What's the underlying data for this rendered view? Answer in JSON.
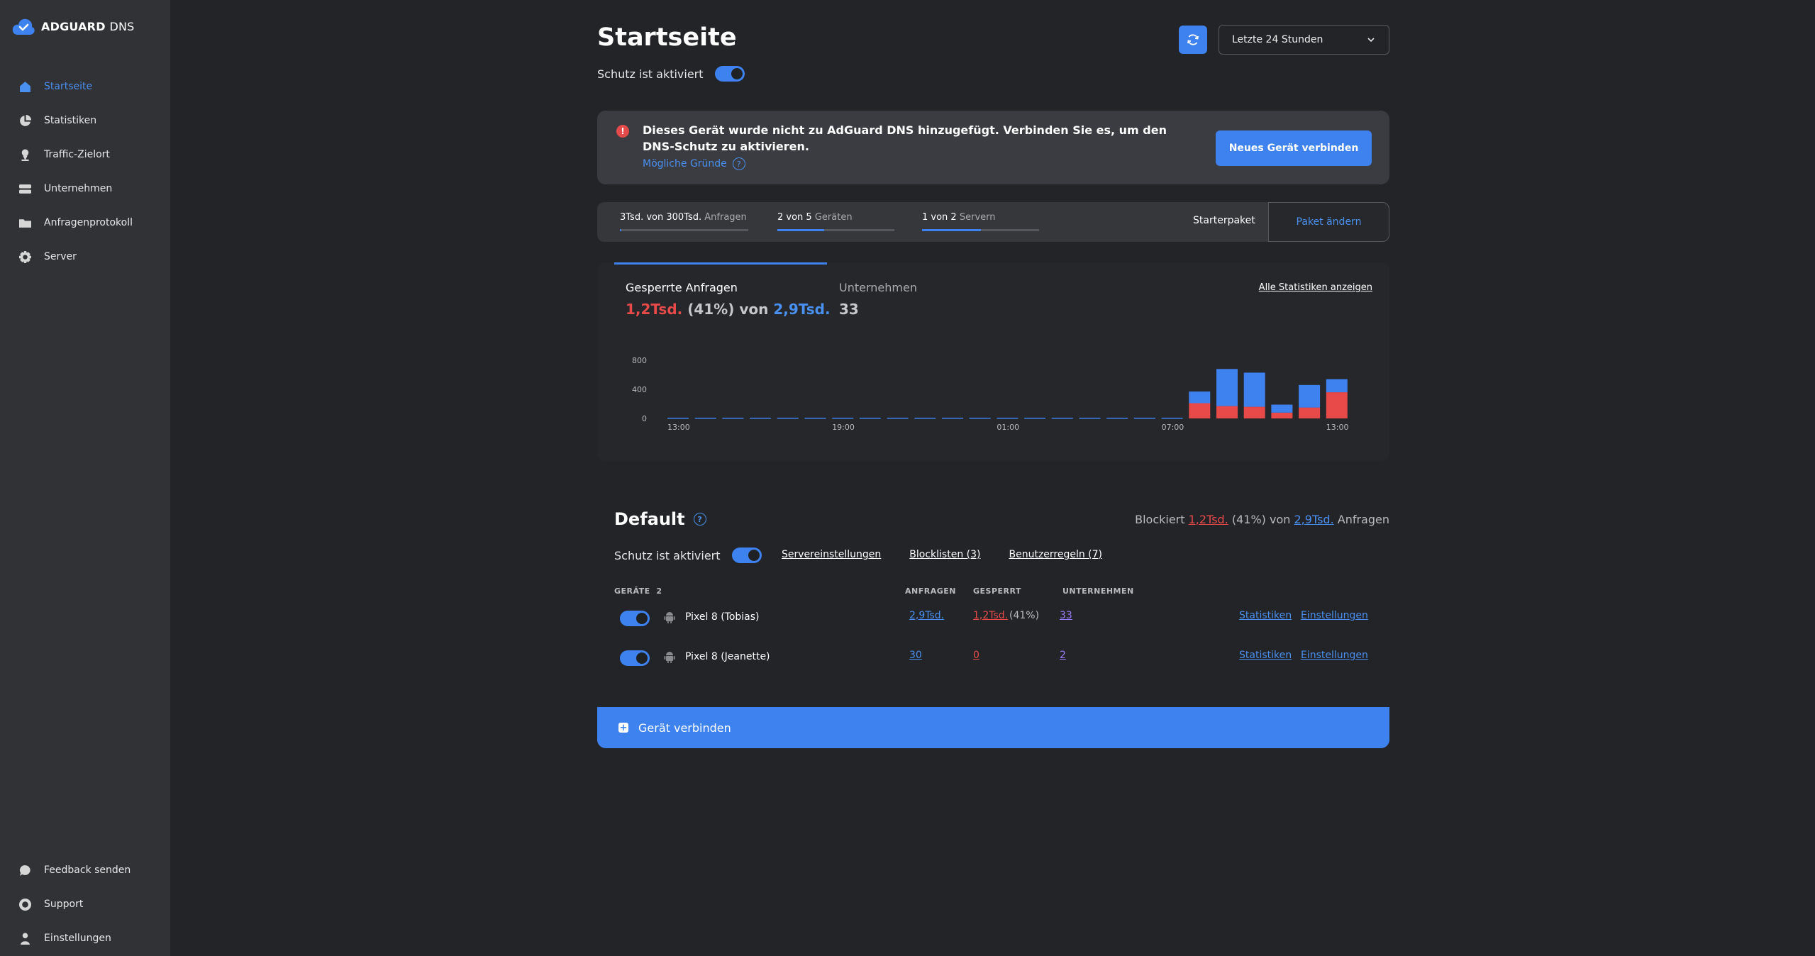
{
  "app": {
    "brand_bold": "ADGUARD",
    "brand_light": "DNS"
  },
  "sidebar": {
    "items": [
      {
        "label": "Startseite",
        "icon": "home-icon",
        "active": true
      },
      {
        "label": "Statistiken",
        "icon": "pie-chart-icon"
      },
      {
        "label": "Traffic-Zielort",
        "icon": "location-icon"
      },
      {
        "label": "Unternehmen",
        "icon": "company-icon"
      },
      {
        "label": "Anfragenprotokoll",
        "icon": "folder-icon"
      },
      {
        "label": "Server",
        "icon": "gear-icon"
      }
    ],
    "bottom_items": [
      {
        "label": "Feedback senden",
        "icon": "chat-icon"
      },
      {
        "label": "Support",
        "icon": "support-icon"
      },
      {
        "label": "Einstellungen",
        "icon": "user-icon"
      }
    ]
  },
  "header": {
    "title": "Startseite",
    "protection_label": "Schutz ist aktiviert",
    "protection_on": true,
    "range_value": "Letzte 24 Stunden"
  },
  "alert": {
    "text": "Dieses Gerät wurde nicht zu AdGuard DNS hinzugefügt. Verbinden Sie es, um den DNS-Schutz zu aktivieren.",
    "link": "Mögliche Gründe",
    "button": "Neues Gerät verbinden"
  },
  "usage": {
    "requests": {
      "value": "3Tsd. von 300Tsd.",
      "unit": "Anfragen",
      "fraction": 0.01
    },
    "devices": {
      "value": "2 von 5",
      "unit": "Geräten",
      "fraction": 0.4
    },
    "servers": {
      "value": "1 von 2",
      "unit": "Servern",
      "fraction": 0.5
    },
    "plan": "Starterpaket",
    "change_plan": "Paket ändern"
  },
  "stats": {
    "blocked_label": "Gesperrte Anfragen",
    "blocked_value": "1,2Tsd.",
    "blocked_pct": "(41%) von",
    "total_value": "2,9Tsd.",
    "companies_label": "Unternehmen",
    "companies_value": "33",
    "all_stats_link": "Alle Statistiken anzeigen"
  },
  "chart_data": {
    "type": "bar",
    "stacked": true,
    "x_tick_labels": [
      "13:00",
      "19:00",
      "01:00",
      "07:00",
      "13:00"
    ],
    "y_ticks": [
      0,
      400,
      800
    ],
    "ylim": [
      0,
      800
    ],
    "grid": false,
    "legend": "none",
    "colors": {
      "blocked": "#e84a4a",
      "allowed": "#3e82f0"
    },
    "series": [
      {
        "values": [
          0,
          0,
          0,
          0,
          0,
          0,
          0,
          0,
          0,
          0,
          0,
          0,
          0,
          0,
          0,
          0,
          0,
          0,
          0,
          210,
          170,
          160,
          80,
          150,
          360
        ]
      },
      {
        "values": [
          0,
          0,
          0,
          0,
          0,
          0,
          0,
          0,
          0,
          0,
          0,
          0,
          0,
          0,
          0,
          0,
          0,
          0,
          0,
          160,
          510,
          470,
          110,
          310,
          180
        ]
      }
    ]
  },
  "default_group": {
    "title": "Default",
    "summary_prefix": "Blockiert",
    "summary_blocked": "1,2Tsd.",
    "summary_middle": "(41%) von",
    "summary_total": "2,9Tsd.",
    "summary_suffix": "Anfragen",
    "protection_label": "Schutz ist aktiviert",
    "links": [
      "Servereinstellungen",
      "Blocklisten (3)",
      "Benutzerregeln (7)"
    ],
    "columns": {
      "devices": "GERÄTE",
      "devices_count": "2",
      "requests": "ANFRAGEN",
      "blocked": "GESPERRT",
      "companies": "UNTERNEHMEN"
    },
    "rows": [
      {
        "name": "Pixel 8 (Tobias)",
        "requests": "2,9Tsd.",
        "blocked": "1,2Tsd.",
        "blocked_pct": "(41%)",
        "companies": "33",
        "stats_link": "Statistiken",
        "settings_link": "Einstellungen"
      },
      {
        "name": "Pixel 8 (Jeanette)",
        "requests": "30",
        "blocked": "0",
        "blocked_pct": "",
        "companies": "2",
        "stats_link": "Statistiken",
        "settings_link": "Einstellungen"
      }
    ],
    "connect_button": "Gerät verbinden"
  }
}
